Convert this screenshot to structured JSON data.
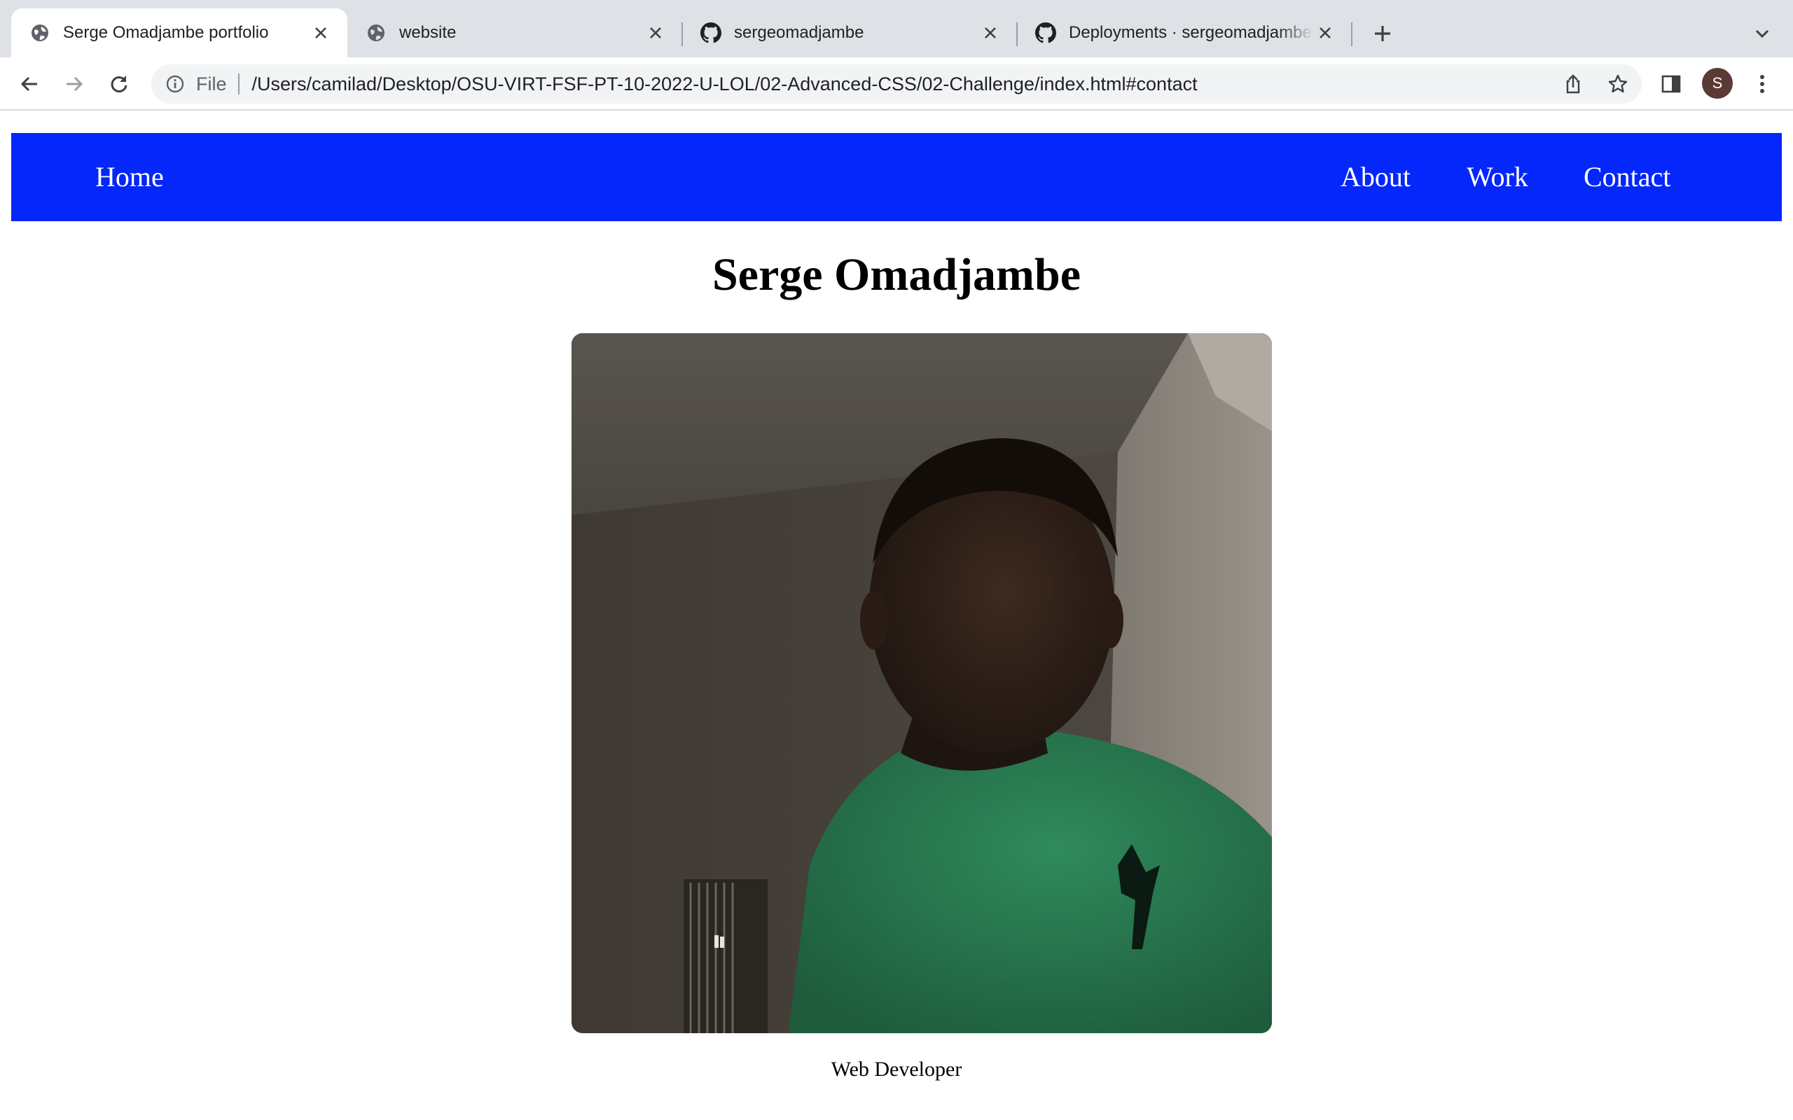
{
  "browser": {
    "tabs": [
      {
        "title": "Serge Omadjambe portfolio",
        "favicon": "globe-icon",
        "active": true
      },
      {
        "title": "website",
        "favicon": "globe-icon",
        "active": false
      },
      {
        "title": "sergeomadjambe",
        "favicon": "github-icon",
        "active": false
      },
      {
        "title": "Deployments · sergeomadjambe",
        "favicon": "github-icon",
        "active": false
      }
    ],
    "address_bar": {
      "scheme_label": "File",
      "url": "/Users/camilad/Desktop/OSU-VIRT-FSF-PT-10-2022-U-LOL/02-Advanced-CSS/02-Challenge/index.html#contact"
    },
    "profile_initial": "S"
  },
  "page": {
    "nav": {
      "home": "Home",
      "about": "About",
      "work": "Work",
      "contact": "Contact"
    },
    "title": "Serge Omadjambe",
    "role": "Web Developer"
  },
  "colors": {
    "nav_bg": "#0527fb",
    "nav_text": "#ffffff",
    "chrome_bg": "#dee1e6"
  }
}
